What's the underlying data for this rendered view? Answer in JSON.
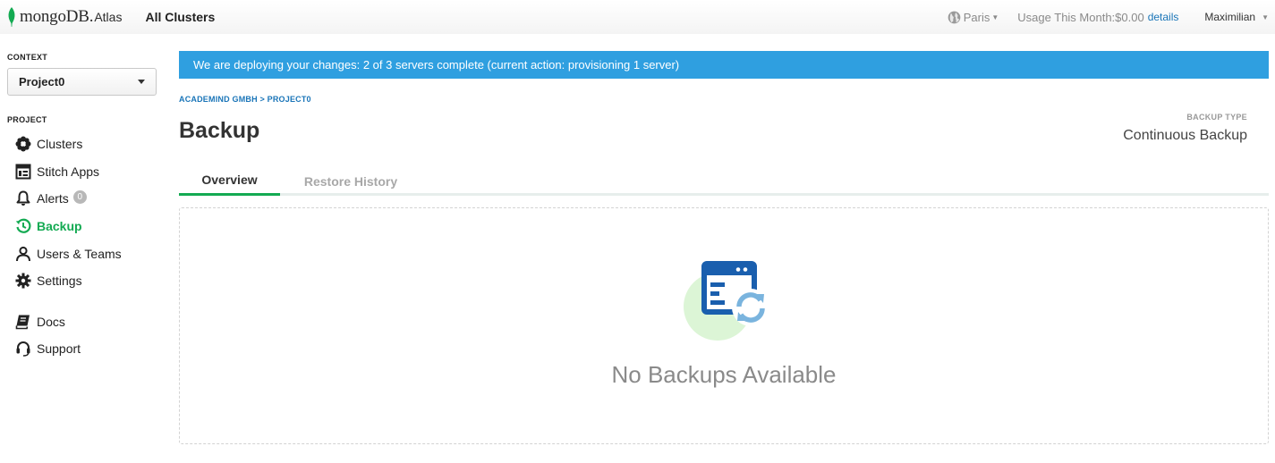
{
  "header": {
    "logo_text": "mongoDB.",
    "logo_suffix": "Atlas",
    "org_switcher": "All Clusters",
    "region": "Paris",
    "usage_text": "Usage This Month:$0.00",
    "details_link": "details",
    "user_name": "Maximilian"
  },
  "sidebar": {
    "context_label": "CONTEXT",
    "context_value": "Project0",
    "project_label": "PROJECT",
    "items": [
      {
        "label": "Clusters",
        "icon": "clusters-icon"
      },
      {
        "label": "Stitch Apps",
        "icon": "stitch-icon"
      },
      {
        "label": "Alerts",
        "icon": "bell-icon",
        "badge": "0"
      },
      {
        "label": "Backup",
        "icon": "backup-icon",
        "active": true
      },
      {
        "label": "Users & Teams",
        "icon": "user-icon"
      },
      {
        "label": "Settings",
        "icon": "gear-icon"
      }
    ],
    "footer_items": [
      {
        "label": "Docs",
        "icon": "book-icon"
      },
      {
        "label": "Support",
        "icon": "headset-icon"
      }
    ]
  },
  "banner": {
    "text": "We are deploying your changes: 2 of 3 servers complete (current action: provisioning 1 server)"
  },
  "main": {
    "breadcrumb": "ACADEMIND GMBH > PROJECT0",
    "title": "Backup",
    "backup_type_label": "BACKUP TYPE",
    "backup_type_value": "Continuous Backup",
    "tabs": [
      "Overview",
      "Restore History"
    ],
    "active_tab": "Overview",
    "empty_message": "No Backups Available"
  },
  "colors": {
    "accent_green": "#13aa52",
    "banner_blue": "#2f9fe0",
    "link_blue": "#1a75b8"
  }
}
